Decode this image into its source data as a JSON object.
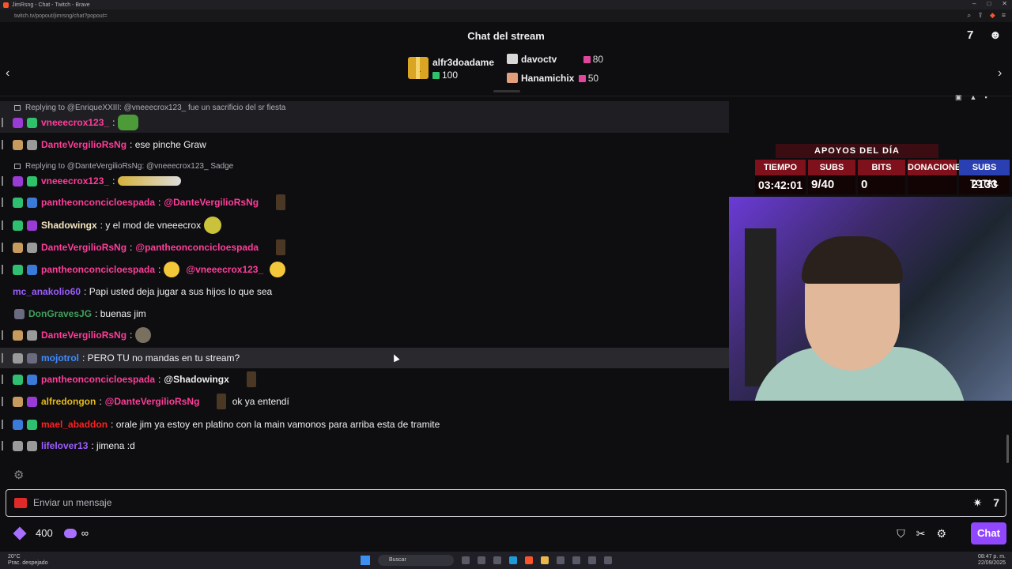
{
  "browser": {
    "window_title": "JimRsng - Chat - Twitch - Brave",
    "url": "twitch.tv/popout/jimrsng/chat?popout=",
    "window_controls": [
      "–",
      "□",
      "✕"
    ]
  },
  "header": {
    "title": "Chat del stream",
    "left_icon": "7tv-logo-icon",
    "right_icon": "users-icon"
  },
  "gift_leaderboard": {
    "first": {
      "rank": "1",
      "name": "alfr3doadame",
      "count": "100"
    },
    "others": [
      {
        "name": "davoctv",
        "count": "80"
      },
      {
        "name": "Hanamichix",
        "count": "50"
      }
    ]
  },
  "messages": [
    {
      "type": "reply",
      "text": "Replying to @EnriqueXXIII: @vneeecrox123_ fue un sacrificio del sr fiesta"
    },
    {
      "type": "msg",
      "user": "vneeecrox123_",
      "text": ""
    },
    {
      "type": "msg",
      "user": "DanteVergilioRsNg",
      "text": "ese pinche Graw"
    },
    {
      "type": "reply",
      "text": "Replying to @DanteVergilioRsNg: @vneeecrox123_ Sadge"
    },
    {
      "type": "msg",
      "user": "vneeecrox123_",
      "text": ""
    },
    {
      "type": "msg",
      "user": "pantheonconcicloespada",
      "mention": "@DanteVergilioRsNg",
      "text": ""
    },
    {
      "type": "msg",
      "user": "Shadowingx",
      "text": "y el mod de vneeecrox"
    },
    {
      "type": "msg",
      "user": "DanteVergilioRsNg",
      "mention": "@pantheonconcicloespada",
      "text": ""
    },
    {
      "type": "msg",
      "user": "pantheonconcicloespada",
      "mention": "@vneeecrox123_",
      "text": ""
    },
    {
      "type": "msg",
      "user": "mc_anakolio60",
      "text": "Papi usted deja jugar a sus hijos lo que sea"
    },
    {
      "type": "msg",
      "user": "DonGravesJG",
      "text": "buenas jim"
    },
    {
      "type": "msg",
      "user": "DanteVergilioRsNg",
      "text": ""
    },
    {
      "type": "msg",
      "user": "mojotrol",
      "text": "PERO TU no mandas en tu stream?"
    },
    {
      "type": "msg",
      "user": "pantheonconcicloespada",
      "mention": "@Shadowingx",
      "text": ""
    },
    {
      "type": "msg",
      "user": "alfredongon",
      "mention": "@DanteVergilioRsNg",
      "text": "ok ya entendí"
    },
    {
      "type": "msg",
      "user": "mael_abaddon",
      "text": "orale jim ya estoy en platino con la main vamonos para arriba esta de tramite"
    },
    {
      "type": "msg",
      "user": "lifelover13",
      "text": "jimena :d"
    }
  ],
  "overlay": {
    "title": "APOYOS DEL DÍA",
    "labels": [
      "TIEMPO",
      "SUBS",
      "BITS",
      "DONACIONES",
      "SUBS TOTAL"
    ],
    "values": [
      "03:42:01",
      "9/40",
      "0",
      "",
      "2133"
    ]
  },
  "input": {
    "placeholder": "Enviar un mensaje"
  },
  "footer": {
    "points": "400",
    "infinity": "∞",
    "chat_button": "Chat"
  },
  "taskbar": {
    "weather_temp": "20°C",
    "weather_desc": "Prac. despejado",
    "search": "Buscar",
    "time": "08:47 p. m.",
    "date": "22/09/2025"
  }
}
